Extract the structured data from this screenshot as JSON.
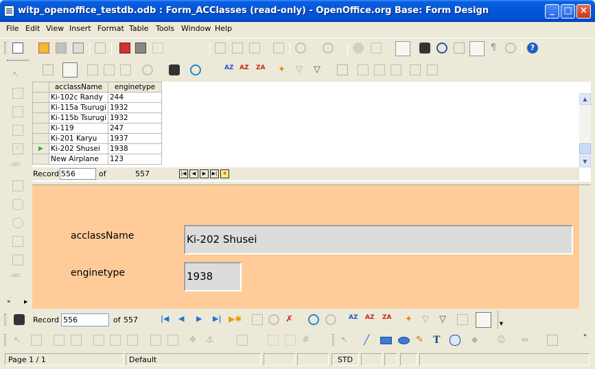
{
  "window": {
    "title": "witp_openoffice_testdb.odb : Form_ACClasses (read-only) - OpenOffice.org Base: Form Design",
    "minimize": "_",
    "maximize": "□",
    "close": "×"
  },
  "menu": {
    "file": "File",
    "edit": "Edit",
    "view": "View",
    "insert": "Insert",
    "format": "Format",
    "table": "Table",
    "tools": "Tools",
    "window": "Window",
    "help": "Help"
  },
  "grid": {
    "columns": [
      "acclassName",
      "enginetype"
    ],
    "rows": [
      {
        "name": "Ki-102c Randy",
        "engine": "244"
      },
      {
        "name": "Ki-115a Tsurugi",
        "engine": "1932"
      },
      {
        "name": "Ki-115b Tsurugi",
        "engine": "1932"
      },
      {
        "name": "Ki-119",
        "engine": "247"
      },
      {
        "name": "Ki-201 Karyu",
        "engine": "1937"
      },
      {
        "name": "Ki-202 Shusei",
        "engine": "1938"
      },
      {
        "name": "New Airplane",
        "engine": "123"
      }
    ],
    "current_row_index": 5,
    "nav": {
      "record_label": "Record",
      "record_value": "556",
      "of_label": "of",
      "total": "557"
    }
  },
  "form": {
    "field1_label": "acclassName",
    "field1_value": "Ki-202 Shusei",
    "field2_label": "enginetype",
    "field2_value": "1938"
  },
  "form_nav": {
    "record_label": "Record",
    "record_value": "556",
    "of_label": "of",
    "total": "557"
  },
  "status": {
    "page": "Page 1 / 1",
    "style": "Default",
    "mode": "STD"
  },
  "colors": {
    "form_background": "#ffcc99",
    "titlebar": "#0556d8"
  }
}
